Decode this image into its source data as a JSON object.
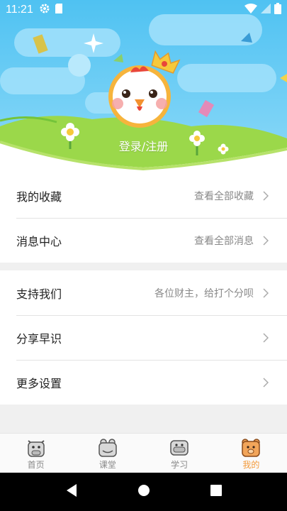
{
  "status_bar": {
    "time": "11:21"
  },
  "profile": {
    "login_label": "登录/注册"
  },
  "menu_group_1": [
    {
      "title": "我的收藏",
      "hint": "查看全部收藏"
    },
    {
      "title": "消息中心",
      "hint": "查看全部消息"
    }
  ],
  "menu_group_2": [
    {
      "title": "支持我们",
      "hint": "各位财主，给打个分呗"
    },
    {
      "title": "分享早识",
      "hint": ""
    },
    {
      "title": "更多设置",
      "hint": ""
    }
  ],
  "tabs": [
    {
      "label": "首页",
      "icon": "cow-icon"
    },
    {
      "label": "课堂",
      "icon": "frog-icon"
    },
    {
      "label": "学习",
      "icon": "hippo-icon"
    },
    {
      "label": "我的",
      "icon": "bear-icon",
      "active": true
    }
  ],
  "colors": {
    "accent": "#f39a3a",
    "sky": "#5dc8f5",
    "grass": "#8ed23a"
  }
}
